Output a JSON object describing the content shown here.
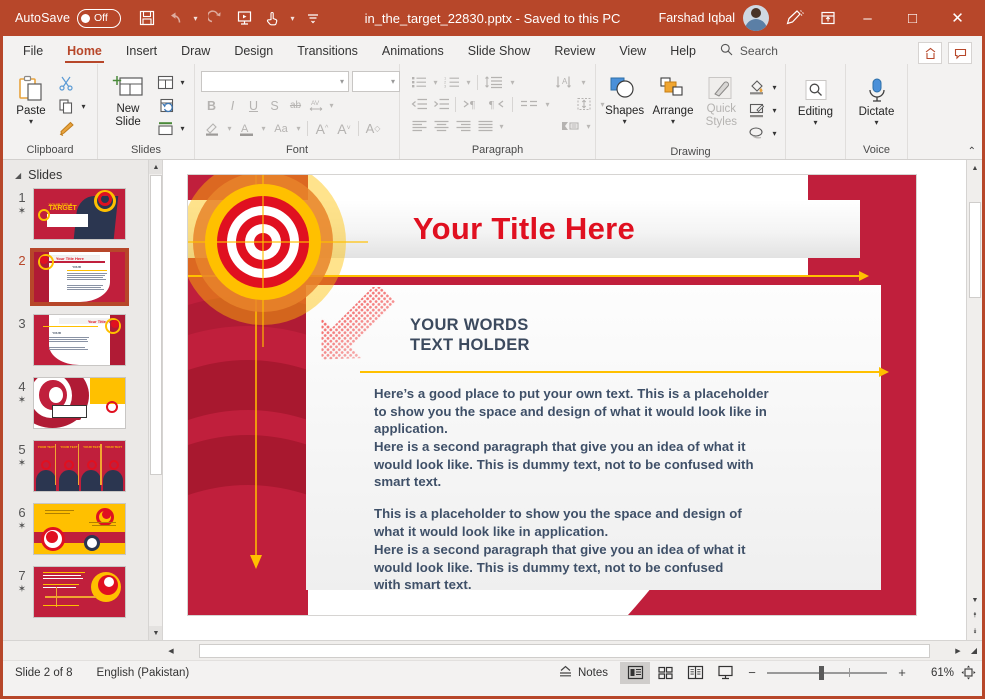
{
  "titlebar": {
    "autosave_label": "AutoSave",
    "autosave_state": "Off",
    "document_title": "in_the_target_22830.pptx  -  Saved to this PC",
    "user_name": "Farshad Iqbal",
    "quick_access": [
      {
        "name": "save-icon",
        "glyph": "save"
      },
      {
        "name": "undo-icon",
        "glyph": "undo"
      },
      {
        "name": "redo-icon",
        "glyph": "redo"
      },
      {
        "name": "start-from-beginning-icon",
        "glyph": "present"
      },
      {
        "name": "touch-mouse-mode-icon",
        "glyph": "touch"
      }
    ],
    "window_controls": {
      "minimize": "‒",
      "maximize": "□",
      "close": "✕"
    }
  },
  "ribbon": {
    "tabs": [
      {
        "label": "File",
        "active": false
      },
      {
        "label": "Home",
        "active": true
      },
      {
        "label": "Insert",
        "active": false
      },
      {
        "label": "Draw",
        "active": false
      },
      {
        "label": "Design",
        "active": false
      },
      {
        "label": "Transitions",
        "active": false
      },
      {
        "label": "Animations",
        "active": false
      },
      {
        "label": "Slide Show",
        "active": false
      },
      {
        "label": "Review",
        "active": false
      },
      {
        "label": "View",
        "active": false
      },
      {
        "label": "Help",
        "active": false
      }
    ],
    "search_placeholder": "Search",
    "share_label": "Share",
    "comments_label": "Comments",
    "groups": {
      "clipboard": {
        "label": "Clipboard",
        "paste_label": "Paste",
        "cut_label": "Cut",
        "copy_label": "Copy",
        "format_painter_label": "Format Painter"
      },
      "slides": {
        "label": "Slides",
        "new_slide_label": "New Slide",
        "layout_label": "Layout",
        "reset_label": "Reset",
        "section_label": "Section"
      },
      "font": {
        "label": "Font",
        "font_name_value": "",
        "font_size_value": "",
        "bold": "B",
        "italic": "I",
        "underline": "U",
        "shadow": "S",
        "strikethrough": "ab",
        "spacing": "AV",
        "highlight": "Text Highlight Color",
        "font_color": "A",
        "change_case": "Aa",
        "increase_size": "A",
        "decrease_size": "A",
        "clear_formatting": "A"
      },
      "paragraph": {
        "label": "Paragraph"
      },
      "drawing": {
        "label": "Drawing",
        "shapes_label": "Shapes",
        "arrange_label": "Arrange",
        "quick_styles_label": "Quick Styles",
        "shape_fill_label": "Shape Fill",
        "shape_outline_label": "Shape Outline",
        "shape_effects_label": "Shape Effects"
      },
      "editing": {
        "label": "",
        "editing_label": "Editing"
      },
      "voice": {
        "label": "Voice",
        "dictate_label": "Dictate"
      }
    }
  },
  "thumbnails": {
    "header": "Slides",
    "items": [
      {
        "number": "1",
        "starred": true,
        "selected": false
      },
      {
        "number": "2",
        "starred": false,
        "selected": true
      },
      {
        "number": "3",
        "starred": false,
        "selected": false
      },
      {
        "number": "4",
        "starred": true,
        "selected": false
      },
      {
        "number": "5",
        "starred": true,
        "selected": false
      },
      {
        "number": "6",
        "starred": true,
        "selected": false
      },
      {
        "number": "7",
        "starred": true,
        "selected": false
      }
    ]
  },
  "slide": {
    "title": "Your Title Here",
    "heading_line1": "YOUR WORDS",
    "heading_line2": "TEXT HOLDER",
    "paragraph1": "Here’s a good place to put your own text. This is a placeholder to show you the space and design of what it would look like in application.",
    "paragraph2": "Here is a second paragraph that give you an idea of what it would look like. This is dummy text, not to be confused with smart text.",
    "paragraph3": "This is a placeholder to show you the space and design of what it would look like in application.",
    "paragraph4": "Here is a second paragraph that give you an idea of what it would look like. This is dummy text, not to be confused with smart text.",
    "colors": {
      "background_red": "#c01f3c",
      "stripe_dark_red": "#b01b35",
      "accent_yellow": "#ffc000",
      "title_red": "#e01020",
      "body_navy": "#3f5068",
      "heading_navy": "#3c4a5e",
      "target_gold": "#ffc000",
      "target_orange": "#e8842a"
    }
  },
  "status": {
    "slide_position": "Slide 2 of 8",
    "language": "English (Pakistan)",
    "notes_label": "Notes",
    "views": [
      {
        "name": "normal-view",
        "active": true
      },
      {
        "name": "slide-sorter-view",
        "active": false
      },
      {
        "name": "reading-view",
        "active": false
      },
      {
        "name": "slide-show-view",
        "active": false
      }
    ],
    "zoom_out": "−",
    "zoom_in": "+",
    "zoom_level": "61%"
  }
}
